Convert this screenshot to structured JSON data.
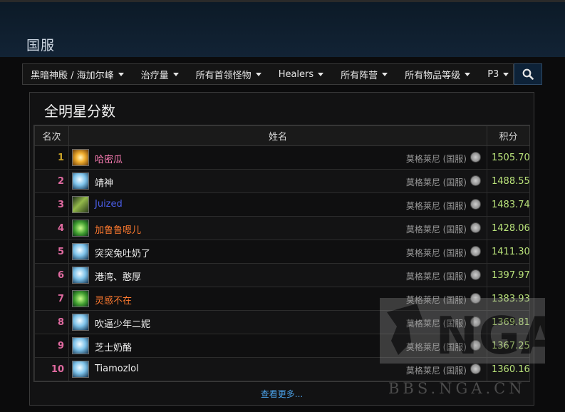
{
  "region_title": "国服",
  "filters": [
    {
      "label": "黑暗神殿 / 海加尔峰"
    },
    {
      "label": "治疗量"
    },
    {
      "label": "所有首领怪物"
    },
    {
      "label": "Healers"
    },
    {
      "label": "所有阵营"
    },
    {
      "label": "所有物品等级"
    },
    {
      "label": "P3"
    }
  ],
  "search_icon": "search-icon",
  "panel_title": "全明星分数",
  "columns": {
    "rank": "名次",
    "name": "姓名",
    "score": "积分"
  },
  "rows": [
    {
      "rank": "1",
      "name": "哈密瓜",
      "name_color": "#ff7eb6",
      "server": "莫格莱尼 (国服)",
      "score": "1505.70",
      "icon": "holy-paladin-icon"
    },
    {
      "rank": "2",
      "name": "靖神",
      "name_color": "#f0f0f0",
      "server": "莫格莱尼 (国服)",
      "score": "1488.55",
      "icon": "priest-icon"
    },
    {
      "rank": "3",
      "name": "Juized",
      "name_color": "#4b5ee8",
      "server": "莫格莱尼 (国服)",
      "score": "1483.74",
      "icon": "shaman-icon"
    },
    {
      "rank": "4",
      "name": "加鲁鲁嗯儿",
      "name_color": "#ff7a2f",
      "server": "莫格莱尼 (国服)",
      "score": "1428.06",
      "icon": "druid-icon"
    },
    {
      "rank": "5",
      "name": "突突兔吐奶了",
      "name_color": "#f0f0f0",
      "server": "莫格莱尼 (国服)",
      "score": "1411.30",
      "icon": "priest-icon"
    },
    {
      "rank": "6",
      "name": "港湾、憨厚",
      "name_color": "#f0f0f0",
      "server": "莫格莱尼 (国服)",
      "score": "1397.97",
      "icon": "priest-icon"
    },
    {
      "rank": "7",
      "name": "灵感不在",
      "name_color": "#ff7a2f",
      "server": "莫格莱尼 (国服)",
      "score": "1383.93",
      "icon": "druid-icon"
    },
    {
      "rank": "8",
      "name": "吹逼少年二妮",
      "name_color": "#f0f0f0",
      "server": "莫格莱尼 (国服)",
      "score": "1369.81",
      "icon": "priest-icon"
    },
    {
      "rank": "9",
      "name": "芝士奶酪",
      "name_color": "#f0f0f0",
      "server": "莫格莱尼 (国服)",
      "score": "1367.25",
      "icon": "priest-icon"
    },
    {
      "rank": "10",
      "name": "Tiamozlol",
      "name_color": "#f0f0f0",
      "server": "莫格莱尼 (国服)",
      "score": "1360.16",
      "icon": "priest-icon"
    }
  ],
  "see_more": "查看更多...",
  "watermark": {
    "logo": "NGA",
    "url": "BBS.NGA.CN"
  }
}
